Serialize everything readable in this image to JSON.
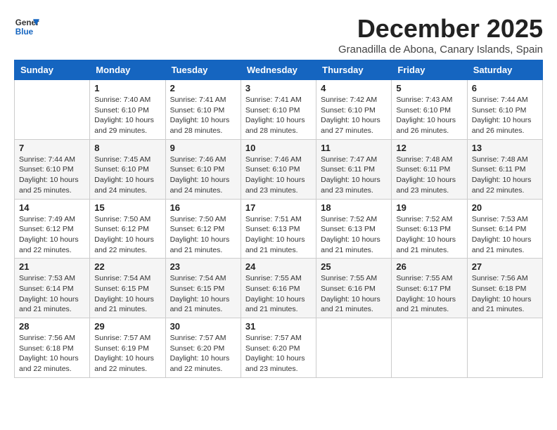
{
  "logo": {
    "general": "General",
    "blue": "Blue"
  },
  "header": {
    "month_title": "December 2025",
    "location": "Granadilla de Abona, Canary Islands, Spain"
  },
  "days_of_week": [
    "Sunday",
    "Monday",
    "Tuesday",
    "Wednesday",
    "Thursday",
    "Friday",
    "Saturday"
  ],
  "weeks": [
    [
      {
        "day": "",
        "info": ""
      },
      {
        "day": "1",
        "info": "Sunrise: 7:40 AM\nSunset: 6:10 PM\nDaylight: 10 hours and 29 minutes."
      },
      {
        "day": "2",
        "info": "Sunrise: 7:41 AM\nSunset: 6:10 PM\nDaylight: 10 hours and 28 minutes."
      },
      {
        "day": "3",
        "info": "Sunrise: 7:41 AM\nSunset: 6:10 PM\nDaylight: 10 hours and 28 minutes."
      },
      {
        "day": "4",
        "info": "Sunrise: 7:42 AM\nSunset: 6:10 PM\nDaylight: 10 hours and 27 minutes."
      },
      {
        "day": "5",
        "info": "Sunrise: 7:43 AM\nSunset: 6:10 PM\nDaylight: 10 hours and 26 minutes."
      },
      {
        "day": "6",
        "info": "Sunrise: 7:44 AM\nSunset: 6:10 PM\nDaylight: 10 hours and 26 minutes."
      }
    ],
    [
      {
        "day": "7",
        "info": "Sunrise: 7:44 AM\nSunset: 6:10 PM\nDaylight: 10 hours and 25 minutes."
      },
      {
        "day": "8",
        "info": "Sunrise: 7:45 AM\nSunset: 6:10 PM\nDaylight: 10 hours and 24 minutes."
      },
      {
        "day": "9",
        "info": "Sunrise: 7:46 AM\nSunset: 6:10 PM\nDaylight: 10 hours and 24 minutes."
      },
      {
        "day": "10",
        "info": "Sunrise: 7:46 AM\nSunset: 6:10 PM\nDaylight: 10 hours and 23 minutes."
      },
      {
        "day": "11",
        "info": "Sunrise: 7:47 AM\nSunset: 6:11 PM\nDaylight: 10 hours and 23 minutes."
      },
      {
        "day": "12",
        "info": "Sunrise: 7:48 AM\nSunset: 6:11 PM\nDaylight: 10 hours and 23 minutes."
      },
      {
        "day": "13",
        "info": "Sunrise: 7:48 AM\nSunset: 6:11 PM\nDaylight: 10 hours and 22 minutes."
      }
    ],
    [
      {
        "day": "14",
        "info": "Sunrise: 7:49 AM\nSunset: 6:12 PM\nDaylight: 10 hours and 22 minutes."
      },
      {
        "day": "15",
        "info": "Sunrise: 7:50 AM\nSunset: 6:12 PM\nDaylight: 10 hours and 22 minutes."
      },
      {
        "day": "16",
        "info": "Sunrise: 7:50 AM\nSunset: 6:12 PM\nDaylight: 10 hours and 21 minutes."
      },
      {
        "day": "17",
        "info": "Sunrise: 7:51 AM\nSunset: 6:13 PM\nDaylight: 10 hours and 21 minutes."
      },
      {
        "day": "18",
        "info": "Sunrise: 7:52 AM\nSunset: 6:13 PM\nDaylight: 10 hours and 21 minutes."
      },
      {
        "day": "19",
        "info": "Sunrise: 7:52 AM\nSunset: 6:13 PM\nDaylight: 10 hours and 21 minutes."
      },
      {
        "day": "20",
        "info": "Sunrise: 7:53 AM\nSunset: 6:14 PM\nDaylight: 10 hours and 21 minutes."
      }
    ],
    [
      {
        "day": "21",
        "info": "Sunrise: 7:53 AM\nSunset: 6:14 PM\nDaylight: 10 hours and 21 minutes."
      },
      {
        "day": "22",
        "info": "Sunrise: 7:54 AM\nSunset: 6:15 PM\nDaylight: 10 hours and 21 minutes."
      },
      {
        "day": "23",
        "info": "Sunrise: 7:54 AM\nSunset: 6:15 PM\nDaylight: 10 hours and 21 minutes."
      },
      {
        "day": "24",
        "info": "Sunrise: 7:55 AM\nSunset: 6:16 PM\nDaylight: 10 hours and 21 minutes."
      },
      {
        "day": "25",
        "info": "Sunrise: 7:55 AM\nSunset: 6:16 PM\nDaylight: 10 hours and 21 minutes."
      },
      {
        "day": "26",
        "info": "Sunrise: 7:55 AM\nSunset: 6:17 PM\nDaylight: 10 hours and 21 minutes."
      },
      {
        "day": "27",
        "info": "Sunrise: 7:56 AM\nSunset: 6:18 PM\nDaylight: 10 hours and 21 minutes."
      }
    ],
    [
      {
        "day": "28",
        "info": "Sunrise: 7:56 AM\nSunset: 6:18 PM\nDaylight: 10 hours and 22 minutes."
      },
      {
        "day": "29",
        "info": "Sunrise: 7:57 AM\nSunset: 6:19 PM\nDaylight: 10 hours and 22 minutes."
      },
      {
        "day": "30",
        "info": "Sunrise: 7:57 AM\nSunset: 6:20 PM\nDaylight: 10 hours and 22 minutes."
      },
      {
        "day": "31",
        "info": "Sunrise: 7:57 AM\nSunset: 6:20 PM\nDaylight: 10 hours and 23 minutes."
      },
      {
        "day": "",
        "info": ""
      },
      {
        "day": "",
        "info": ""
      },
      {
        "day": "",
        "info": ""
      }
    ]
  ]
}
